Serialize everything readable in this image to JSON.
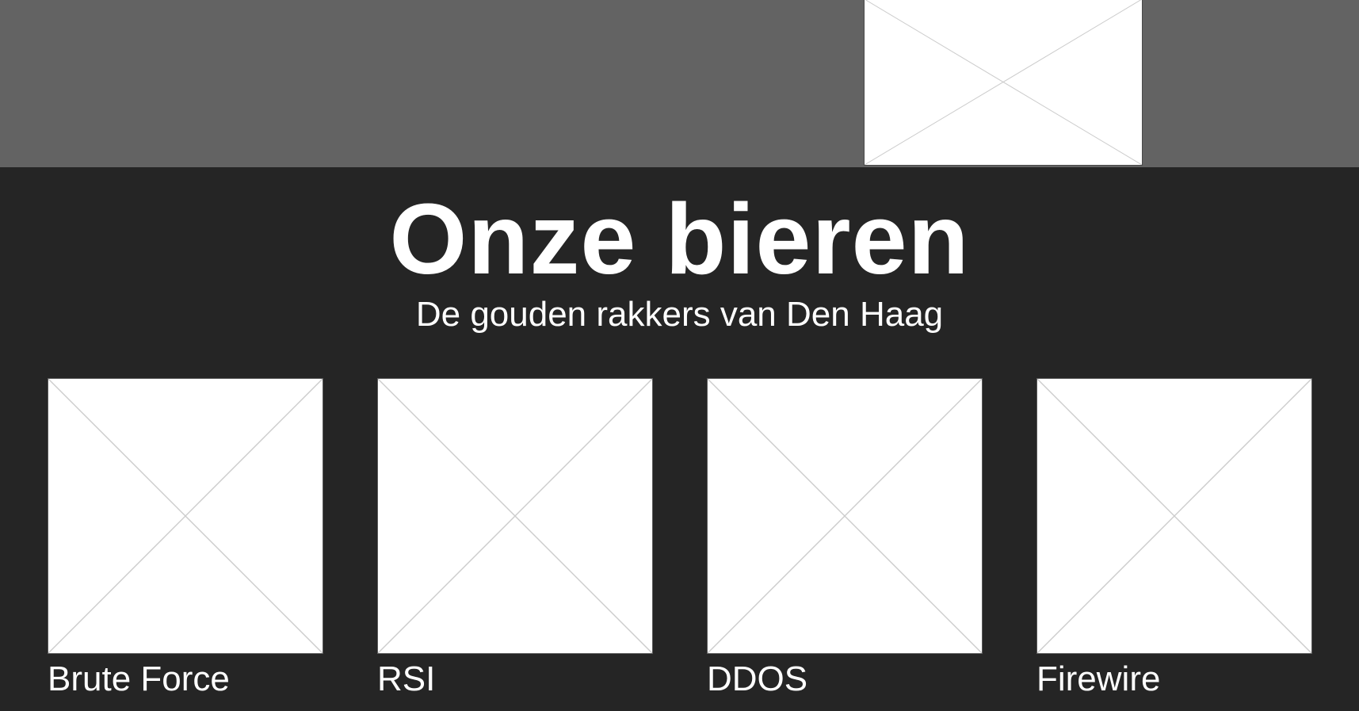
{
  "section": {
    "title": "Onze bieren",
    "subtitle": "De gouden rakkers van Den Haag"
  },
  "beers": [
    {
      "name": "Brute Force"
    },
    {
      "name": "RSI"
    },
    {
      "name": "DDOS"
    },
    {
      "name": "Firewire"
    }
  ],
  "colors": {
    "hero_band": "#636363",
    "section_background": "#252525",
    "text": "#ffffff",
    "placeholder_fill": "#ffffff",
    "placeholder_lines": "#cccccc"
  }
}
